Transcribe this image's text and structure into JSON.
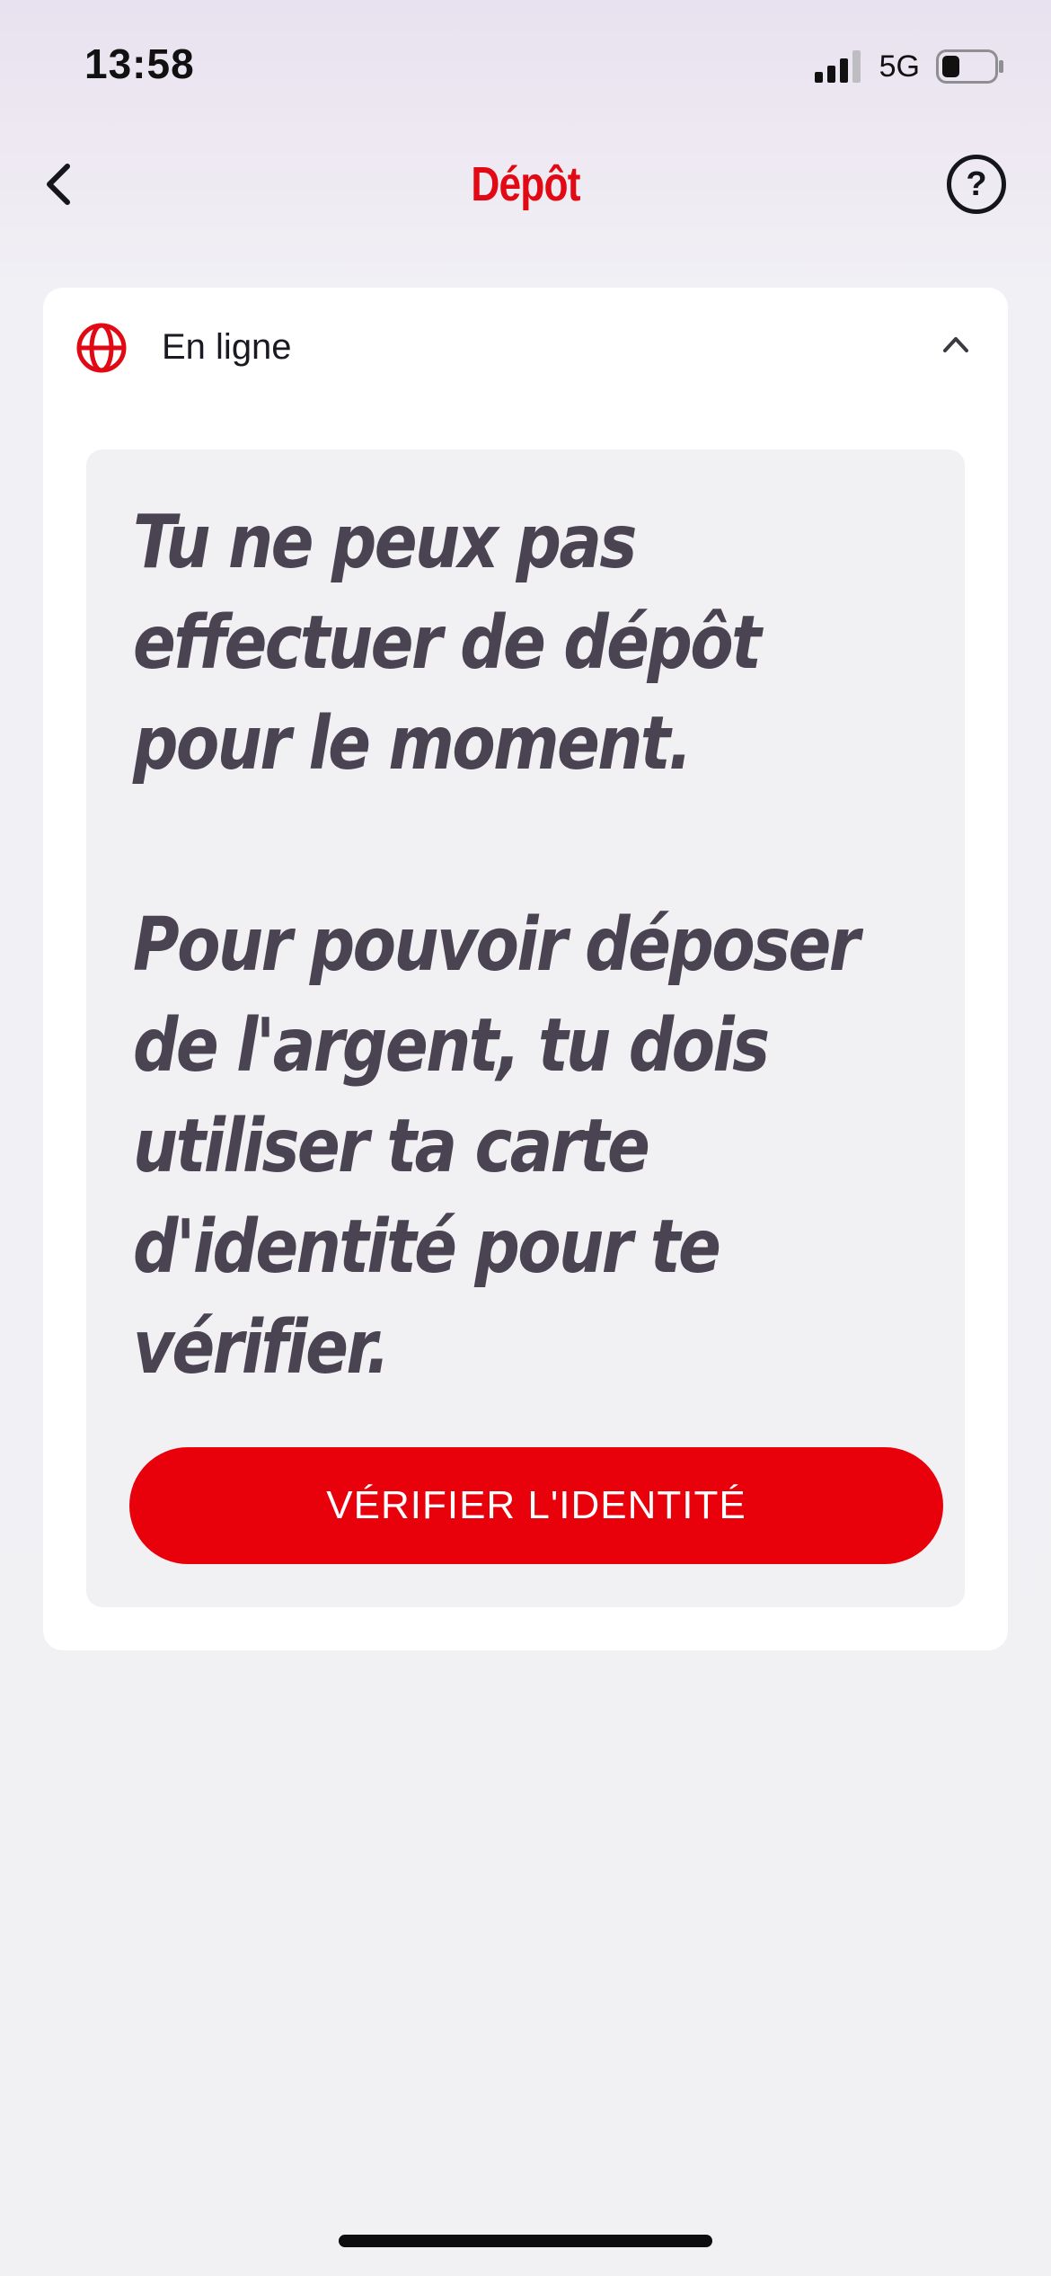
{
  "status_bar": {
    "time": "13:58",
    "network": "5G",
    "battery_level": 0.35
  },
  "header": {
    "title": "Dépôt",
    "back_icon": "chevron-left-icon",
    "help_icon": "question-circle-icon",
    "help_glyph": "?"
  },
  "card": {
    "header": {
      "icon": "globe-icon",
      "label": "En ligne",
      "toggle_icon": "chevron-up-icon"
    },
    "notice": {
      "paragraph_1": "Tu ne peux pas effectuer de dépôt pour le moment.",
      "paragraph_2": "Pour pouvoir déposer de l'argent, tu dois utiliser ta carte d'identité pour te vérifier."
    },
    "verify_button_label": "VÉRIFIER L'IDENTITÉ"
  },
  "colors": {
    "brand_red": "#e8000b",
    "title_red": "#e10a14",
    "notice_text": "#4a4352",
    "notice_background": "#f1f0f3"
  }
}
